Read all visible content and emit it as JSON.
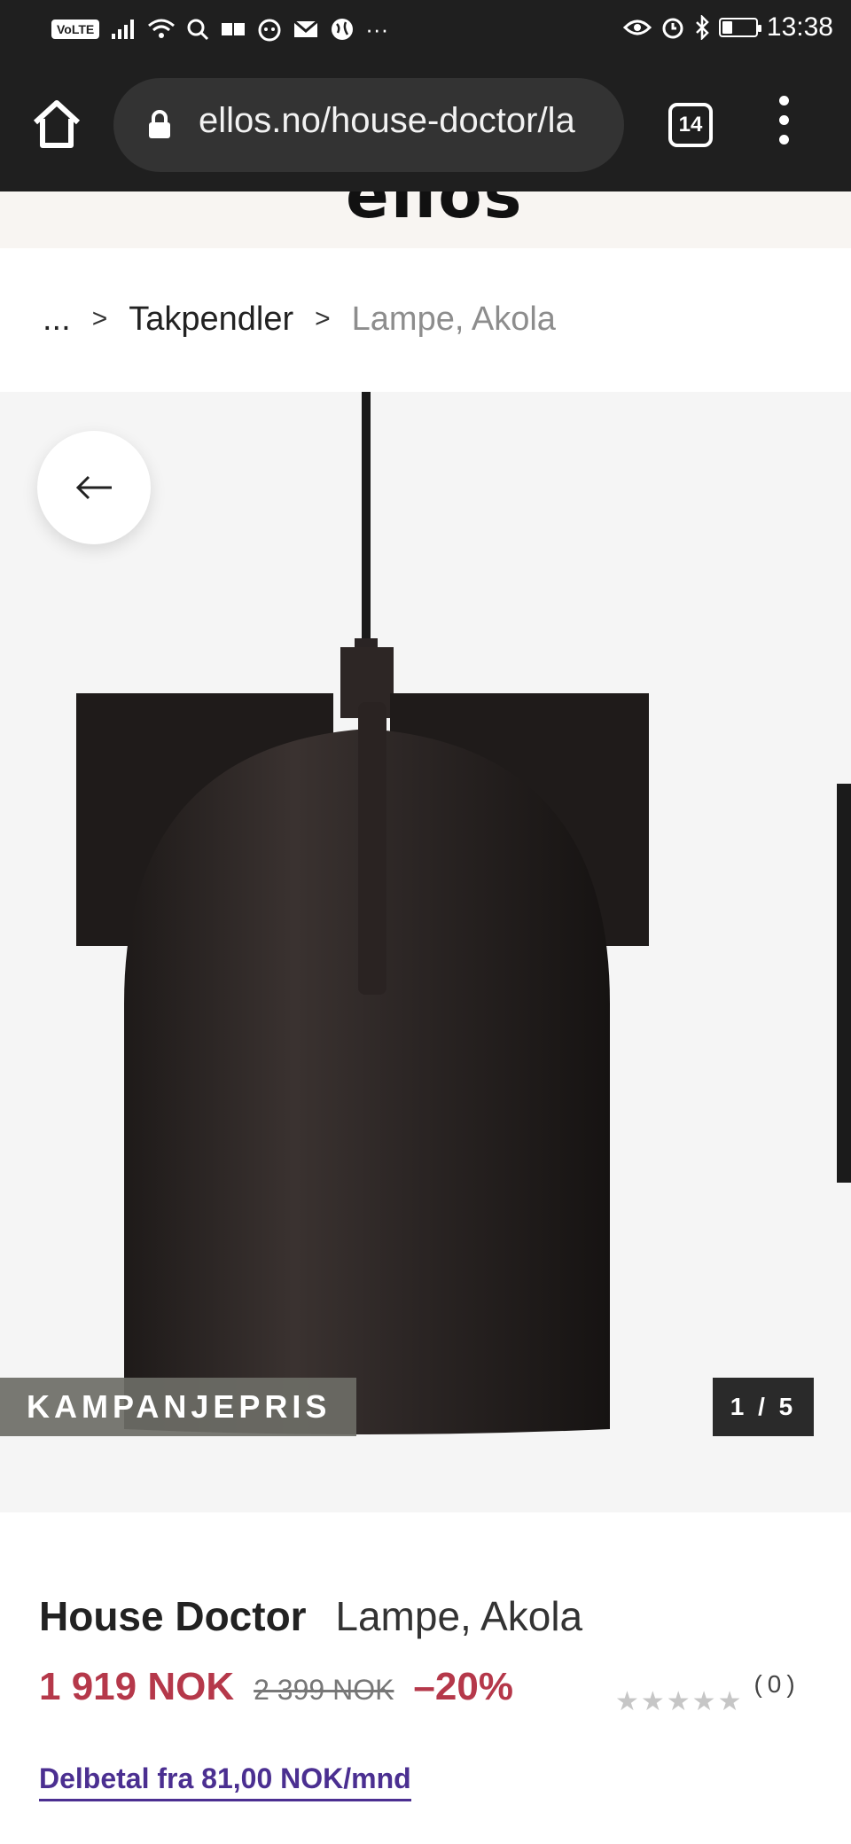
{
  "status_bar": {
    "network_badge": "VoLTE",
    "overflow": "···",
    "time": "13:38",
    "battery_level": 0.3,
    "icons": [
      "signal-icon",
      "wifi-icon",
      "search-icon",
      "mail-icon",
      "globe-icon",
      "eye-icon",
      "alarm-icon",
      "bluetooth-icon",
      "battery-icon"
    ]
  },
  "browser": {
    "url": "ellos.no/house-doctor/la",
    "tab_count": "14",
    "icons": [
      "home-icon",
      "lock-icon",
      "tabs-icon",
      "menu-icon"
    ]
  },
  "site": {
    "logo": "ellos"
  },
  "breadcrumb": {
    "ellipsis": "...",
    "separator": ">",
    "category": "Takpendler",
    "current": "Lampe, Akola"
  },
  "gallery": {
    "badge": "KAMPANJEPRIS",
    "counter": "1 / 5",
    "current_image": 1,
    "total_images": 5
  },
  "product": {
    "brand": "House Doctor",
    "name": "Lampe, Akola",
    "price": "1 919 NOK",
    "old_price": "2 399 NOK",
    "discount": "–20%",
    "rating_stars": "★★★★★",
    "rating_value": 0,
    "rating_count": "(0)",
    "installment": "Delbetal fra 81,00 NOK/mnd"
  },
  "colors": {
    "sale": "#b5384a",
    "link": "#4b2f91",
    "chrome": "#1f1f1f"
  }
}
